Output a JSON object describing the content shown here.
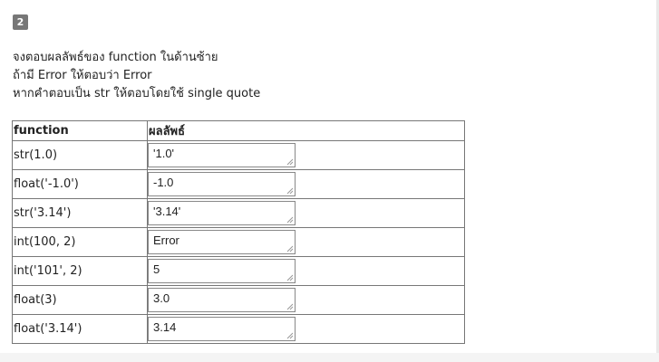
{
  "question": {
    "number": "2",
    "lines": [
      "จงตอบผลลัพธ์ของ function ในด้านซ้าย",
      "ถ้ามี Error ให้ตอบว่า Error",
      "หากคำตอบเป็น str ให้ตอบโดยใช้ single quote"
    ]
  },
  "table": {
    "headers": [
      "function",
      "ผลลัพธ์"
    ],
    "rows": [
      {
        "function": "str(1.0)",
        "answer": "'1.0'"
      },
      {
        "function": "float('-1.0')",
        "answer": "-1.0"
      },
      {
        "function": "str('3.14')",
        "answer": "'3.14'"
      },
      {
        "function": "int(100, 2)",
        "answer": "Error"
      },
      {
        "function": "int('101', 2)",
        "answer": "5"
      },
      {
        "function": "float(3)",
        "answer": "3.0"
      },
      {
        "function": "float('3.14')",
        "answer": "3.14"
      }
    ]
  },
  "icons": {
    "resize": "resize-grip-icon"
  }
}
